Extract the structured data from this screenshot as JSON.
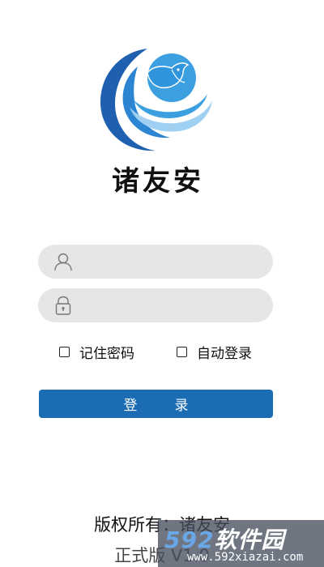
{
  "app": {
    "name": "诸友安"
  },
  "login_form": {
    "username_placeholder": "",
    "password_placeholder": "",
    "remember_password_label": "记住密码",
    "auto_login_label": "自动登录",
    "remember_password_checked": false,
    "auto_login_checked": false,
    "submit_label": "登录"
  },
  "footer": {
    "copyright": "版权所有：诸友安",
    "version": "正式版 V1.0"
  },
  "watermark": {
    "brand_number": "592",
    "brand_text": "软件园",
    "url": "www.592xiazai.com"
  },
  "colors": {
    "primary": "#1b6cb3",
    "input_bg": "#e6e6e6",
    "logo_blue_dark": "#1e5fb0",
    "logo_blue_light": "#3ca0e0",
    "logo_blue_pale": "#9fd0f2"
  },
  "icons": {
    "username": "user-icon",
    "password": "lock-icon"
  }
}
